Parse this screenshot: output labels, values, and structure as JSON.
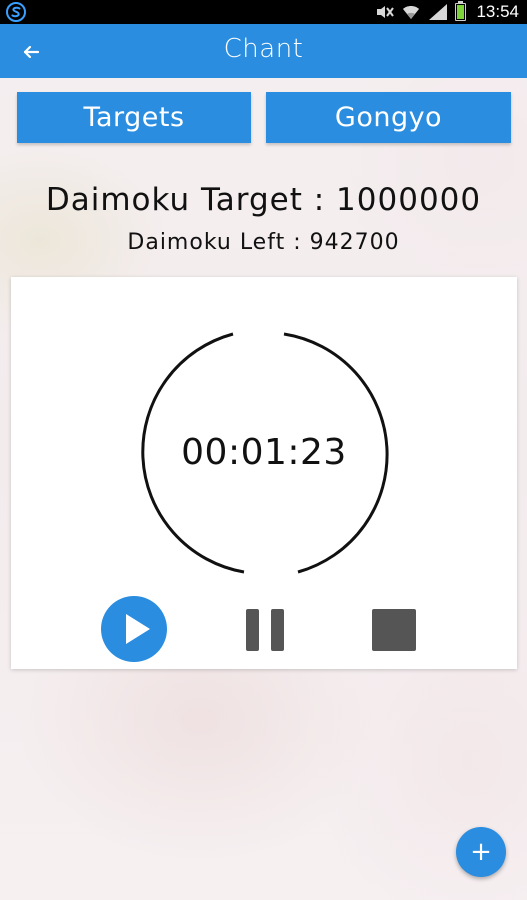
{
  "status_bar": {
    "time": "13:54",
    "left_icon": "sync-s-icon",
    "icons": [
      "mute-icon",
      "wifi-icon",
      "signal-icon",
      "battery-icon"
    ],
    "battery_color": "#7ed23a"
  },
  "app_bar": {
    "title": "Chant",
    "back_icon": "arrow-left-icon",
    "color": "#2a8de0"
  },
  "tabs": [
    {
      "label": "Targets"
    },
    {
      "label": "Gongyo"
    }
  ],
  "target": {
    "text": "Daimoku Target : 1000000",
    "left_text": "Daimoku Left : 942700"
  },
  "timer": {
    "elapsed": "00:01:23"
  },
  "controls": {
    "play_icon": "play-icon",
    "pause_icon": "pause-icon",
    "stop_icon": "stop-icon"
  },
  "fab": {
    "label": "+",
    "icon": "plus-icon"
  }
}
